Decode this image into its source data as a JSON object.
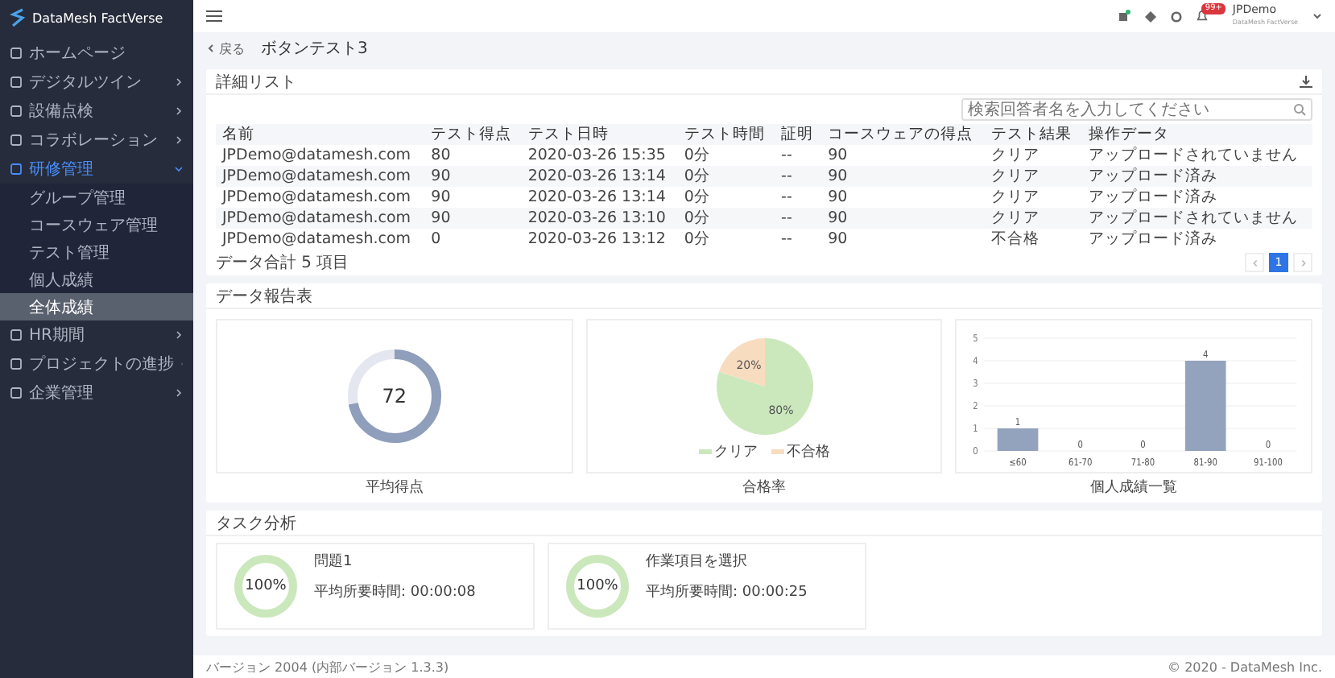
{
  "app": {
    "brand": "DataMesh FactVerse"
  },
  "sidebar": {
    "items": [
      {
        "label": "ホームページ",
        "selected": false
      },
      {
        "label": "デジタルツイン",
        "selected": false,
        "expanded": false
      },
      {
        "label": "設備点検",
        "selected": false,
        "expanded": false
      },
      {
        "label": "コラボレーション",
        "selected": false,
        "expanded": false
      },
      {
        "label": "研修管理",
        "selected": true,
        "expanded": true,
        "children": [
          {
            "label": "グループ管理",
            "selected": false
          },
          {
            "label": "コースウェア管理",
            "selected": false
          },
          {
            "label": "テスト管理",
            "selected": false
          },
          {
            "label": "個人成績",
            "selected": false
          },
          {
            "label": "全体成績",
            "selected": true
          }
        ]
      },
      {
        "label": "HR期間",
        "selected": false,
        "expanded": false
      },
      {
        "label": "プロジェクトの進捗",
        "selected": false,
        "expanded": false
      },
      {
        "label": "企業管理",
        "selected": false,
        "expanded": false
      }
    ]
  },
  "header": {
    "notification_badge": "99+",
    "user": {
      "name": "JPDemo",
      "subtitle": "DataMesh FactVerse"
    }
  },
  "breadcrumb": {
    "back": "戻る",
    "title": "ボタンテスト3"
  },
  "detail_list": {
    "title": "詳細リスト",
    "search": {
      "placeholder": "検索回答者名を入力してください"
    },
    "columns": [
      "名前",
      "テスト得点",
      "テスト日時",
      "テスト時間",
      "証明",
      "コースウェアの得点",
      "テスト結果",
      "操作データ"
    ],
    "rows": [
      [
        "JPDemo@datamesh.com",
        "80",
        "2020-03-26 15:35",
        "0分",
        "--",
        "90",
        "クリア",
        "アップロードされていません"
      ],
      [
        "JPDemo@datamesh.com",
        "90",
        "2020-03-26 13:14",
        "0分",
        "--",
        "90",
        "クリア",
        "アップロード済み"
      ],
      [
        "JPDemo@datamesh.com",
        "90",
        "2020-03-26 13:14",
        "0分",
        "--",
        "90",
        "クリア",
        "アップロード済み"
      ],
      [
        "JPDemo@datamesh.com",
        "90",
        "2020-03-26 13:10",
        "0分",
        "--",
        "90",
        "クリア",
        "アップロードされていません"
      ],
      [
        "JPDemo@datamesh.com",
        "0",
        "2020-03-26 13:12",
        "0分",
        "--",
        "90",
        "不合格",
        "アップロード済み"
      ]
    ],
    "total": "データ合計 5 項目",
    "pages": [
      {
        "label": "1",
        "selected": true
      }
    ]
  },
  "report": {
    "title": "データ報告表",
    "average": {
      "value": "72",
      "level": 0.72,
      "caption": "平均得点"
    },
    "pass_rate": {
      "caption": "合格率",
      "chart_data": {
        "type": "pie",
        "categories": [
          "クリア",
          "不合格"
        ],
        "values": [
          80,
          20
        ],
        "colors": [
          "#cbe8bd",
          "#f8dcc0"
        ],
        "data_labels": true,
        "value_labels": [
          "80%",
          "20%"
        ]
      }
    },
    "distribution": {
      "caption": "個人成績一覧",
      "chart_data": {
        "type": "bar",
        "categories": [
          "≤60",
          "61-70",
          "71-80",
          "81-90",
          "91-100"
        ],
        "series": [
          {
            "color": "#94a3bd",
            "values": [
              1,
              0,
              0,
              4,
              0
            ]
          }
        ],
        "ylim": [
          0,
          5
        ],
        "yticks": [
          0,
          1,
          2,
          3,
          4,
          5
        ],
        "grid": true,
        "data_labels": true
      }
    }
  },
  "task_analysis": {
    "title": "タスク分析",
    "tasks": [
      {
        "name": "問題1",
        "time": "平均所要時間: 00:00:08",
        "percent": "100%",
        "level": 1
      },
      {
        "name": "作業項目を選択",
        "time": "平均所要時間: 00:00:25",
        "percent": "100%",
        "level": 1
      }
    ]
  },
  "footer": {
    "version": "バージョン 2004 (内部バージョン 1.3.3)",
    "copyright": "© 2020 - DataMesh Inc."
  }
}
